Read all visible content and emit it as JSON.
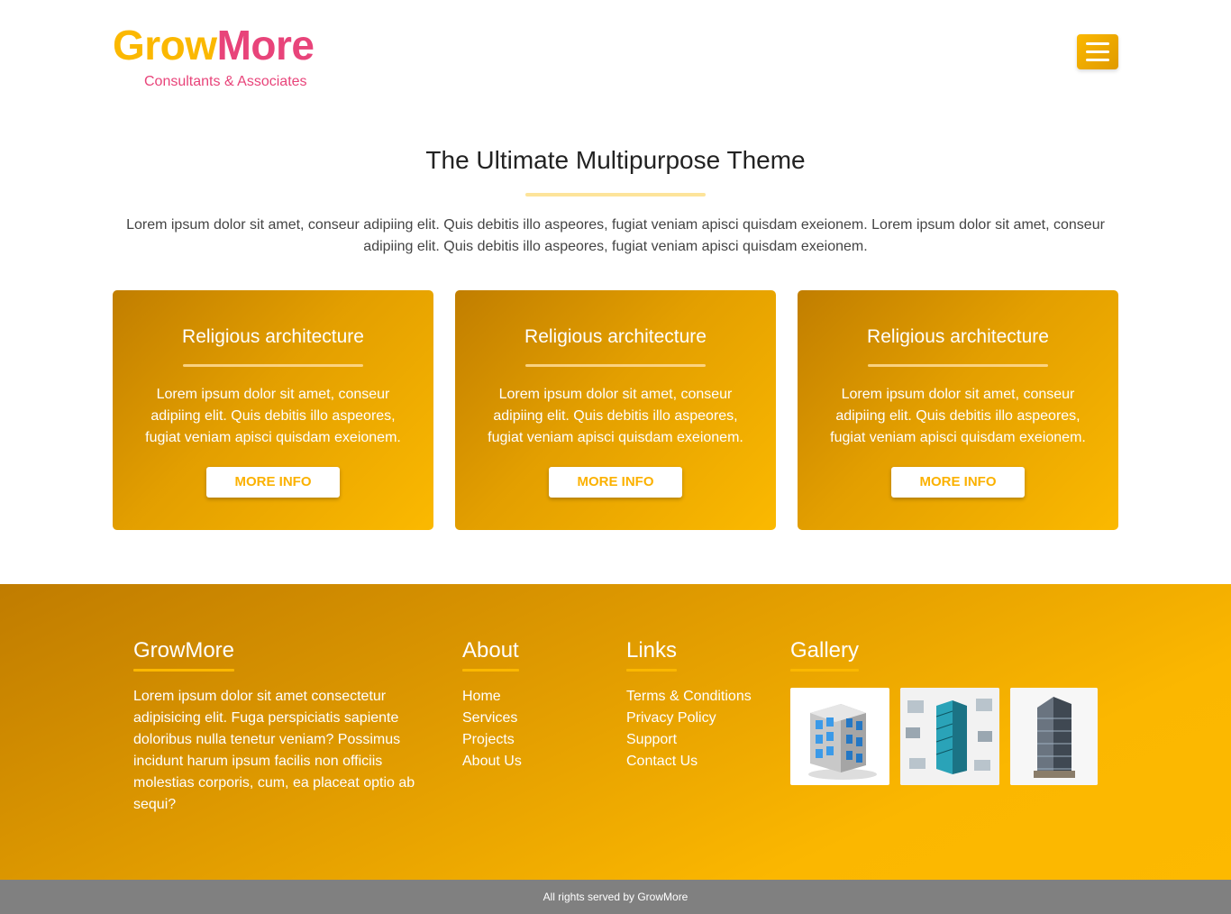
{
  "header": {
    "logo_part1": "Grow",
    "logo_part2": "More",
    "tagline": "Consultants & Associates",
    "menu_icon": "hamburger-icon"
  },
  "intro": {
    "title": "The Ultimate Multipurpose Theme",
    "text": "Lorem ipsum dolor sit amet, conseur adipiing elit. Quis debitis illo aspeores, fugiat veniam apisci quisdam exeionem. Lorem ipsum dolor sit amet, conseur adipiing elit. Quis debitis illo aspeores, fugiat veniam apisci quisdam exeionem."
  },
  "cards": [
    {
      "title": "Religious architecture",
      "text": "Lorem ipsum dolor sit amet, conseur adipiing elit. Quis debitis illo aspeores, fugiat veniam apisci quisdam exeionem.",
      "button": "MORE INFO"
    },
    {
      "title": "Religious architecture",
      "text": "Lorem ipsum dolor sit amet, conseur adipiing elit. Quis debitis illo aspeores, fugiat veniam apisci quisdam exeionem.",
      "button": "MORE INFO"
    },
    {
      "title": "Religious architecture",
      "text": "Lorem ipsum dolor sit amet, conseur adipiing elit. Quis debitis illo aspeores, fugiat veniam apisci quisdam exeionem.",
      "button": "MORE INFO"
    }
  ],
  "footer": {
    "brand": {
      "heading": "GrowMore",
      "text": "Lorem ipsum dolor sit amet consectetur adipisicing elit. Fuga perspiciatis sapiente doloribus nulla tenetur veniam? Possimus incidunt harum ipsum facilis non officiis molestias corporis, cum, ea placeat optio ab sequi?"
    },
    "about": {
      "heading": "About",
      "items": [
        "Home",
        "Services",
        "Projects",
        "About Us"
      ]
    },
    "links": {
      "heading": "Links",
      "items": [
        "Terms & Conditions",
        "Privacy Policy",
        "Support",
        "Contact Us"
      ]
    },
    "gallery": {
      "heading": "Gallery"
    },
    "copyright": "All rights served by GrowMore"
  },
  "colors": {
    "brand_yellow": "#fbb800",
    "brand_pink": "#e8447a",
    "footer_bar": "#808080"
  }
}
